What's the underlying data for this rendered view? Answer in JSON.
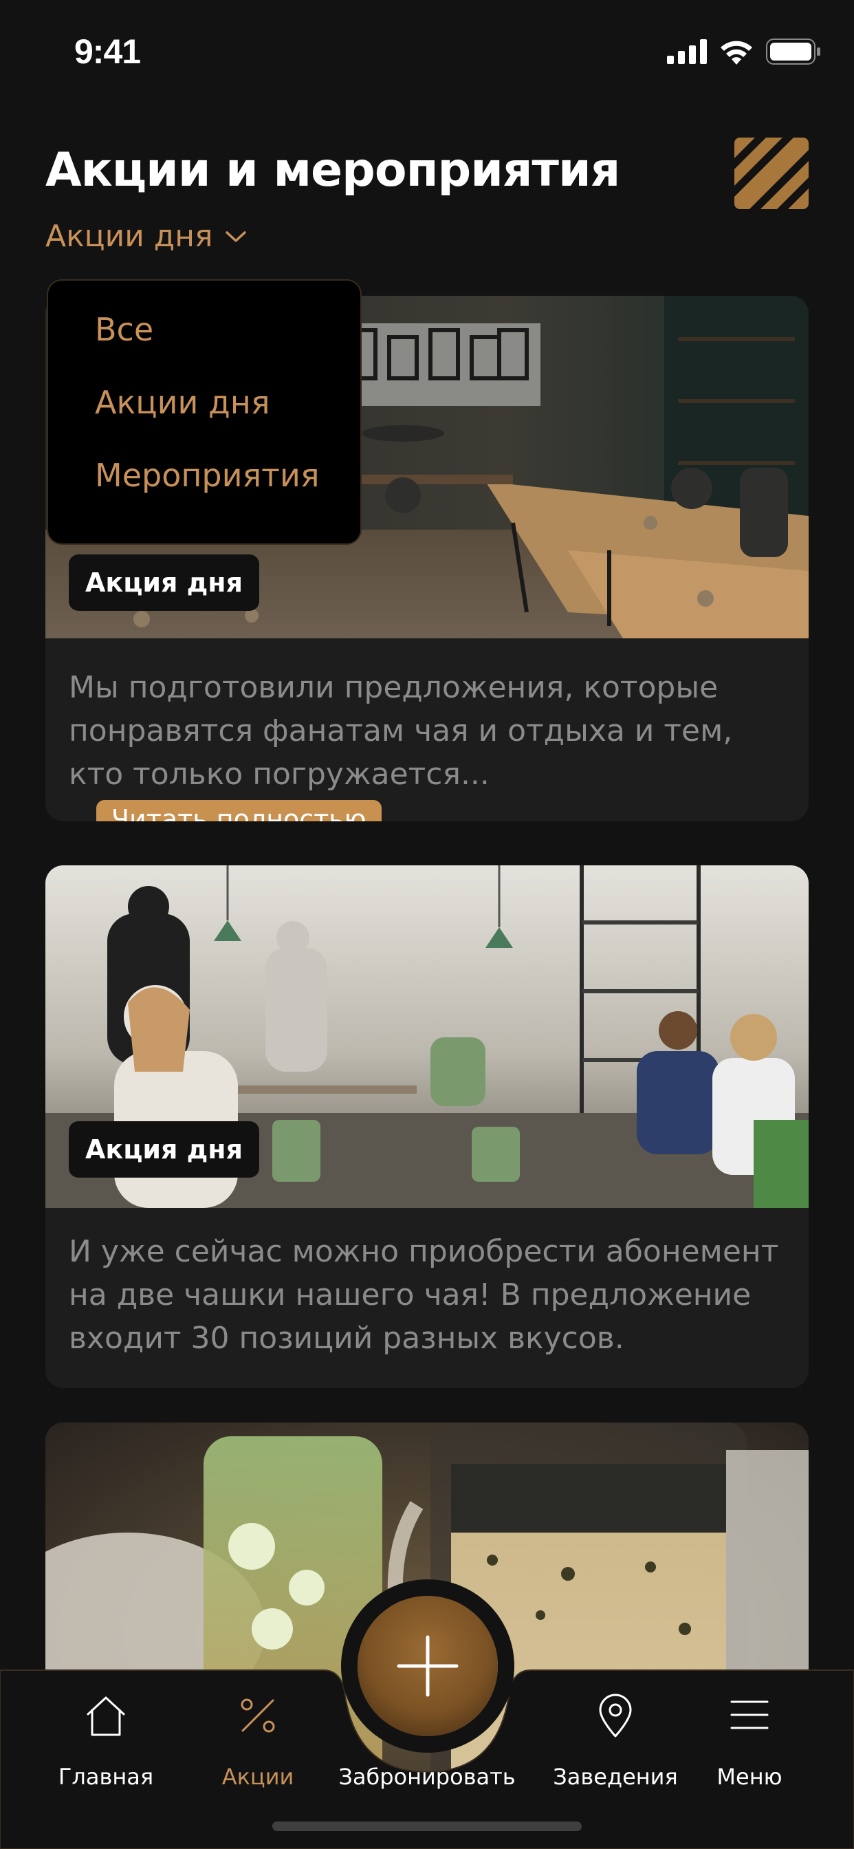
{
  "status_bar": {
    "time": "9:41"
  },
  "header": {
    "title": "Акции и мероприятия",
    "filter_label": "Акции дня"
  },
  "dropdown": {
    "items": [
      "Все",
      "Акции дня",
      "Мероприятия"
    ]
  },
  "cards": [
    {
      "badge": "Акция дня",
      "text": "Мы подготовили предложения, которые понравятся фанатам чая и отдыха и тем, кто только погружается...",
      "read_more": "Читать полностью"
    },
    {
      "badge": "Акция дня",
      "text": "И уже сейчас можно приобрести абонемент на две чашки нашего чая! В предложение входит 30 позиций разных вкусов."
    },
    {
      "badge": "",
      "text": ""
    }
  ],
  "bottom_nav": {
    "items": [
      {
        "label": "Главная",
        "icon": "home-icon"
      },
      {
        "label": "Акции",
        "icon": "percent-icon",
        "active": true
      },
      {
        "label": "Забронировать",
        "icon": "plus-icon"
      },
      {
        "label": "Заведения",
        "icon": "location-pin-icon"
      },
      {
        "label": "Меню",
        "icon": "menu-icon"
      }
    ]
  },
  "colors": {
    "accent": "#c8915a",
    "background": "#121212",
    "card": "#1d1d1d"
  }
}
